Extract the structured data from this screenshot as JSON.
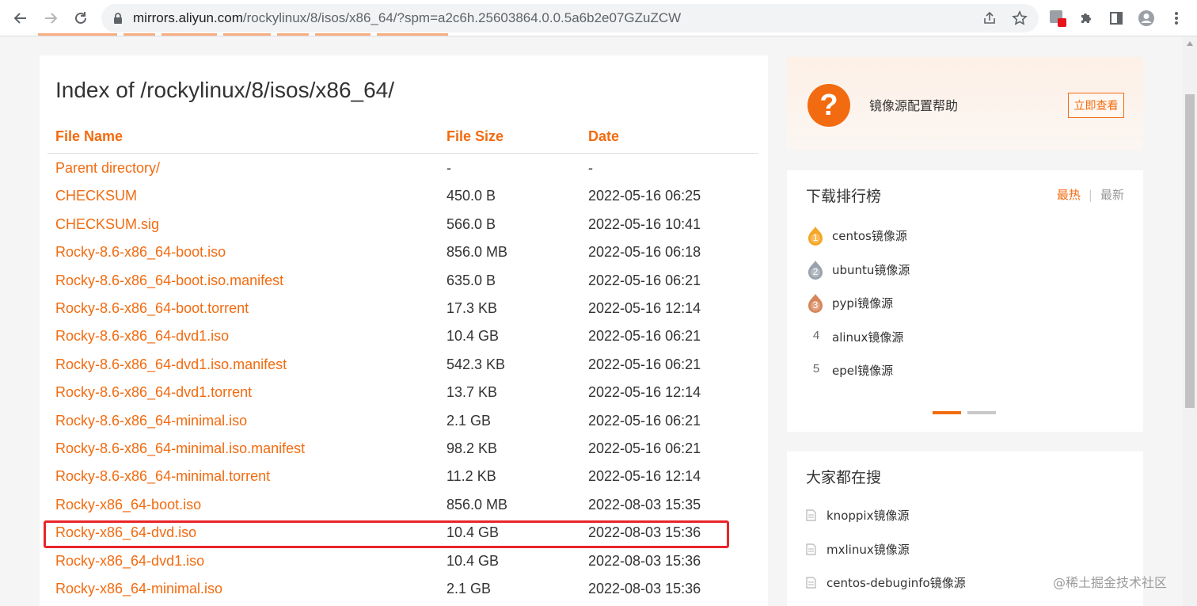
{
  "browser": {
    "url_host": "mirrors.aliyun.com",
    "url_rest": "/rockylinux/8/isos/x86_64/?spm=a2c6h.25603864.0.0.5a6b2e07GZuZCW"
  },
  "main": {
    "heading": "Index of /rockylinux/8/isos/x86_64/",
    "headers": {
      "name": "File Name",
      "size": "File Size",
      "date": "Date"
    },
    "rows": [
      {
        "name": "Parent directory/",
        "size": "-",
        "date": "-"
      },
      {
        "name": "CHECKSUM",
        "size": "450.0 B",
        "date": "2022-05-16 06:25"
      },
      {
        "name": "CHECKSUM.sig",
        "size": "566.0 B",
        "date": "2022-05-16 10:41"
      },
      {
        "name": "Rocky-8.6-x86_64-boot.iso",
        "size": "856.0 MB",
        "date": "2022-05-16 06:18"
      },
      {
        "name": "Rocky-8.6-x86_64-boot.iso.manifest",
        "size": "635.0 B",
        "date": "2022-05-16 06:21"
      },
      {
        "name": "Rocky-8.6-x86_64-boot.torrent",
        "size": "17.3 KB",
        "date": "2022-05-16 12:14"
      },
      {
        "name": "Rocky-8.6-x86_64-dvd1.iso",
        "size": "10.4 GB",
        "date": "2022-05-16 06:21"
      },
      {
        "name": "Rocky-8.6-x86_64-dvd1.iso.manifest",
        "size": "542.3 KB",
        "date": "2022-05-16 06:21"
      },
      {
        "name": "Rocky-8.6-x86_64-dvd1.torrent",
        "size": "13.7 KB",
        "date": "2022-05-16 12:14"
      },
      {
        "name": "Rocky-8.6-x86_64-minimal.iso",
        "size": "2.1 GB",
        "date": "2022-05-16 06:21"
      },
      {
        "name": "Rocky-8.6-x86_64-minimal.iso.manifest",
        "size": "98.2 KB",
        "date": "2022-05-16 06:21"
      },
      {
        "name": "Rocky-8.6-x86_64-minimal.torrent",
        "size": "11.2 KB",
        "date": "2022-05-16 12:14"
      },
      {
        "name": "Rocky-x86_64-boot.iso",
        "size": "856.0 MB",
        "date": "2022-08-03 15:35"
      },
      {
        "name": "Rocky-x86_64-dvd.iso",
        "size": "10.4 GB",
        "date": "2022-08-03 15:36"
      },
      {
        "name": "Rocky-x86_64-dvd1.iso",
        "size": "10.4 GB",
        "date": "2022-08-03 15:36"
      },
      {
        "name": "Rocky-x86_64-minimal.iso",
        "size": "2.1 GB",
        "date": "2022-08-03 15:36"
      }
    ]
  },
  "help": {
    "icon_text": "?",
    "label": "镜像源配置帮助",
    "button": "立即查看"
  },
  "ranking": {
    "title": "下载排行榜",
    "tab_hot": "最热",
    "separator": "|",
    "tab_new": "最新",
    "items": [
      {
        "rank": "1",
        "label": "centos镜像源"
      },
      {
        "rank": "2",
        "label": "ubuntu镜像源"
      },
      {
        "rank": "3",
        "label": "pypi镜像源"
      },
      {
        "rank": "4",
        "label": "alinux镜像源"
      },
      {
        "rank": "5",
        "label": "epel镜像源"
      }
    ]
  },
  "searching": {
    "title": "大家都在搜",
    "items": [
      "knoppix镜像源",
      "mxlinux镜像源",
      "centos-debuginfo镜像源"
    ]
  },
  "watermark": "@稀土掘金技术社区",
  "colors": {
    "accent": "#f26b10",
    "highlight_border": "#e8262a"
  }
}
